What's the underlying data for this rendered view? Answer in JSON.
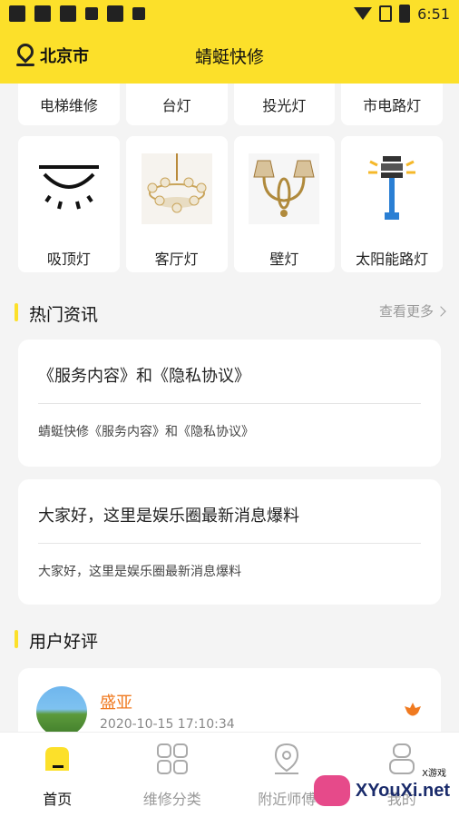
{
  "status_bar": {
    "time": "6:51"
  },
  "header": {
    "city": "北京市",
    "title": "蜻蜓快修"
  },
  "categories_top": [
    {
      "label": "电梯维修"
    },
    {
      "label": "台灯"
    },
    {
      "label": "投光灯"
    },
    {
      "label": "市电路灯"
    }
  ],
  "categories": [
    {
      "label": "吸顶灯",
      "icon": "ceiling-light-icon"
    },
    {
      "label": "客厅灯",
      "icon": "chandelier-image"
    },
    {
      "label": "壁灯",
      "icon": "wall-lamp-image"
    },
    {
      "label": "太阳能路灯",
      "icon": "solar-street-light-icon"
    }
  ],
  "news_section": {
    "title": "热门资讯",
    "more": "查看更多"
  },
  "news": [
    {
      "title": "《服务内容》和《隐私协议》",
      "summary": "蜻蜓快修《服务内容》和《隐私协议》"
    },
    {
      "title": "大家好，这里是娱乐圈最新消息爆料",
      "summary": "大家好，这里是娱乐圈最新消息爆料"
    }
  ],
  "review_section": {
    "title": "用户好评"
  },
  "review": {
    "name": "盛亚",
    "date": "2020-10-15 17:10:34"
  },
  "tabs": [
    {
      "label": "首页",
      "icon": "home-icon",
      "active": true
    },
    {
      "label": "维修分类",
      "icon": "grid-icon",
      "active": false
    },
    {
      "label": "附近师傅",
      "icon": "location-icon",
      "active": false
    },
    {
      "label": "我的",
      "icon": "user-icon",
      "active": false
    }
  ],
  "watermark": {
    "text": "XYouXi.net",
    "small": "X游戏"
  },
  "colors": {
    "accent": "#fce02a",
    "reviewer": "#f07a20"
  }
}
